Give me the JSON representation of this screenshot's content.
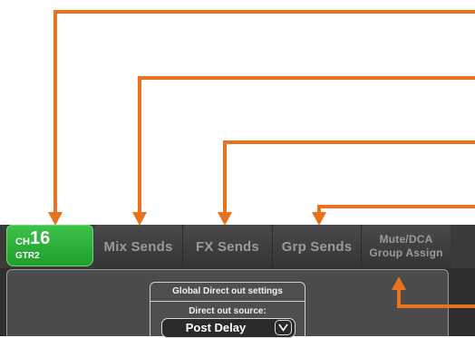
{
  "channel": {
    "prefix": "CH",
    "number": "16",
    "name": "GTR2"
  },
  "tabs": [
    {
      "label": "Mix Sends"
    },
    {
      "label": "FX Sends"
    },
    {
      "label": "Grp Sends"
    },
    {
      "label": "Mute/DCA\nGroup Assign"
    }
  ],
  "panel": {
    "title": "Global Direct out settings",
    "source_label": "Direct out source:",
    "source_value": "Post Delay",
    "chevron_icon": "chevron-down-icon"
  },
  "colors": {
    "annotation": "#e8731e",
    "active_tab": "#2aa836",
    "tab_bar": "#3a3a3a"
  }
}
